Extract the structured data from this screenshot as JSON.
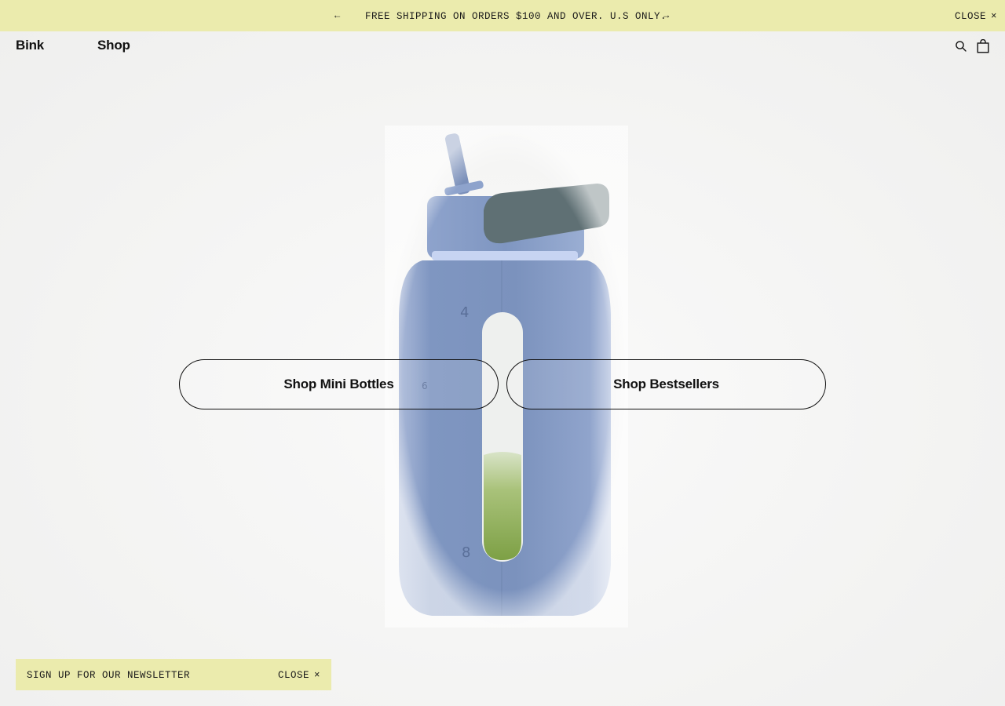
{
  "announcement": {
    "prev_icon": "←",
    "next_icon": "→",
    "message": "FREE SHIPPING ON ORDERS $100 AND OVER. U.S ONLY.",
    "close_label": "CLOSE",
    "close_icon": "×"
  },
  "nav": {
    "logo": "Bink",
    "shop": "Shop",
    "icons": [
      "search-icon",
      "bag-icon"
    ]
  },
  "hero": {
    "image": "bottle-image",
    "bottle_marks": [
      "4",
      "6",
      "8"
    ],
    "cta_left": "Shop Mini Bottles",
    "cta_right": "Shop Bestsellers"
  },
  "newsletter": {
    "label": "SIGN UP FOR OUR NEWSLETTER",
    "close_label": "CLOSE",
    "close_icon": "×"
  },
  "colors": {
    "banner": "#ebebad",
    "background": "#f4f4f3",
    "bottle": "#7f96bf",
    "lid": "#5f7074",
    "water": "#8aab4a",
    "text": "#111111"
  }
}
